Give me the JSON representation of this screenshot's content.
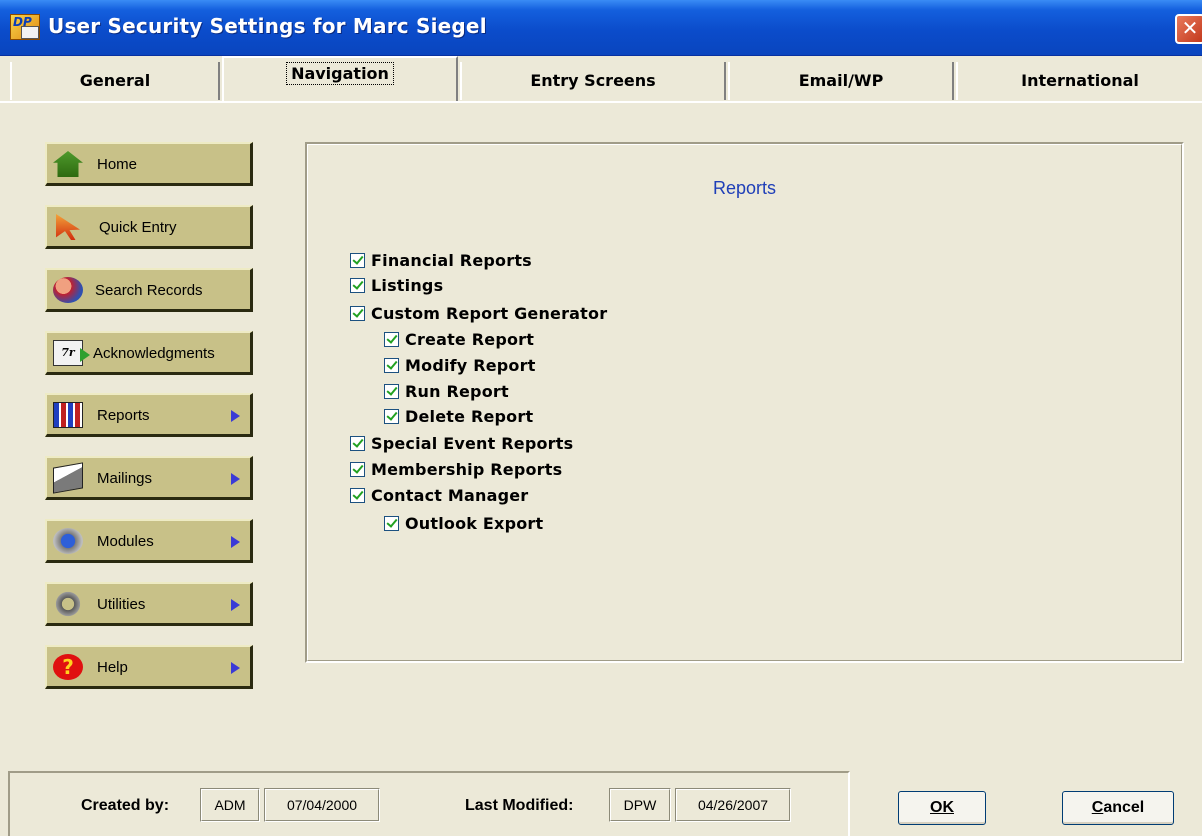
{
  "window": {
    "title": "User Security Settings for Marc Siegel",
    "close_glyph": "✕",
    "app_icon_text": "DP"
  },
  "tabs": [
    {
      "label": "General"
    },
    {
      "label": "Navigation",
      "active": true
    },
    {
      "label": "Entry Screens"
    },
    {
      "label": "Email/WP"
    },
    {
      "label": "International"
    }
  ],
  "nav": {
    "buttons": [
      {
        "label": "Home",
        "icon": "home-icon",
        "has_submenu": false
      },
      {
        "label": "Quick Entry",
        "icon": "quick-entry-icon",
        "has_submenu": false
      },
      {
        "label": "Search Records",
        "icon": "search-records-icon",
        "has_submenu": false
      },
      {
        "label": "Acknowledgments",
        "icon": "acknowledgments-icon",
        "has_submenu": false
      },
      {
        "label": "Reports",
        "icon": "reports-icon",
        "has_submenu": true
      },
      {
        "label": "Mailings",
        "icon": "mailings-icon",
        "has_submenu": true
      },
      {
        "label": "Modules",
        "icon": "modules-icon",
        "has_submenu": true
      },
      {
        "label": "Utilities",
        "icon": "utilities-icon",
        "has_submenu": true
      },
      {
        "label": "Help",
        "icon": "help-icon",
        "has_submenu": true
      }
    ],
    "help_glyph": "?",
    "ack_icon_text": "7r"
  },
  "reports_panel": {
    "title": "Reports",
    "options": [
      {
        "label": "Financial Reports",
        "checked": true,
        "level": 0
      },
      {
        "label": "Listings",
        "checked": true,
        "level": 0
      },
      {
        "label": "Custom Report Generator",
        "checked": true,
        "level": 0
      },
      {
        "label": "Create Report",
        "checked": true,
        "level": 1
      },
      {
        "label": "Modify Report",
        "checked": true,
        "level": 1
      },
      {
        "label": "Run Report",
        "checked": true,
        "level": 1
      },
      {
        "label": "Delete Report",
        "checked": true,
        "level": 1
      },
      {
        "label": "Special Event Reports",
        "checked": true,
        "level": 0
      },
      {
        "label": "Membership Reports",
        "checked": true,
        "level": 0
      },
      {
        "label": "Contact Manager",
        "checked": true,
        "level": 0
      },
      {
        "label": "Outlook Export",
        "checked": true,
        "level": 1
      }
    ]
  },
  "footer": {
    "created_by_label": "Created by:",
    "created_by_user": "ADM",
    "created_date": "07/04/2000",
    "last_modified_label": "Last Modified:",
    "last_modified_user": "DPW",
    "last_modified_date": "04/26/2007",
    "ok_label": "OK",
    "cancel_label": "Cancel"
  },
  "colors": {
    "titlebar_blue": "#0B4CCB",
    "dialog_bg": "#ECE9D8",
    "nav_button": "#C8C188",
    "panel_title": "#1F3FB8",
    "check_green": "#21A121"
  }
}
